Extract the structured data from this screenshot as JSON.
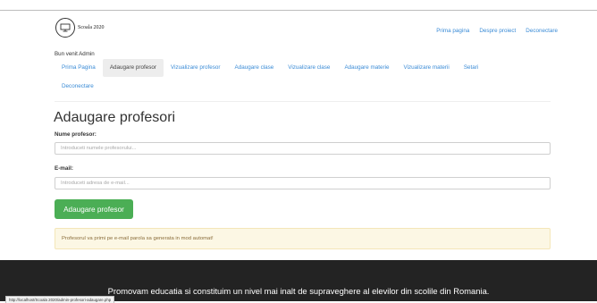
{
  "header": {
    "logo_text": "Scoala 2020",
    "nav": [
      "Prima pagina",
      "Despre proiect",
      "Deconectare"
    ]
  },
  "welcome_text": "Bun venit Admin",
  "subnav": {
    "items": [
      "Prima Pagina",
      "Adaugare profesor",
      "Vizualizare profesor",
      "Adaugare clase",
      "Vizualizare clase",
      "Adaugare materie",
      "Vizualizare materii",
      "Setari",
      "Deconectare"
    ],
    "active_index": 1
  },
  "form": {
    "title": "Adaugare profesori",
    "name_label": "Nume profesor:",
    "name_placeholder": "Introduceti numele profesorului...",
    "email_label": "E-mail:",
    "email_placeholder": "Introduceti adresa de e-mail...",
    "submit_label": "Adaugare profesor"
  },
  "alert_text": "Profesorul va primi pe e-mail parola sa generata in mod automat!",
  "footer_text": "Promovam educatia si constituim un nivel mai inalt de supraveghere al elevilor din scolile din Romania.",
  "status_url": "http://localhost/Scoala 2020/admin-profesori-adaugare.php",
  "colors": {
    "link": "#3a8bd6",
    "button": "#4bae55",
    "alert_bg": "#fcf7e4",
    "alert_text": "#8a6d3b",
    "footer_bg": "#232323"
  }
}
